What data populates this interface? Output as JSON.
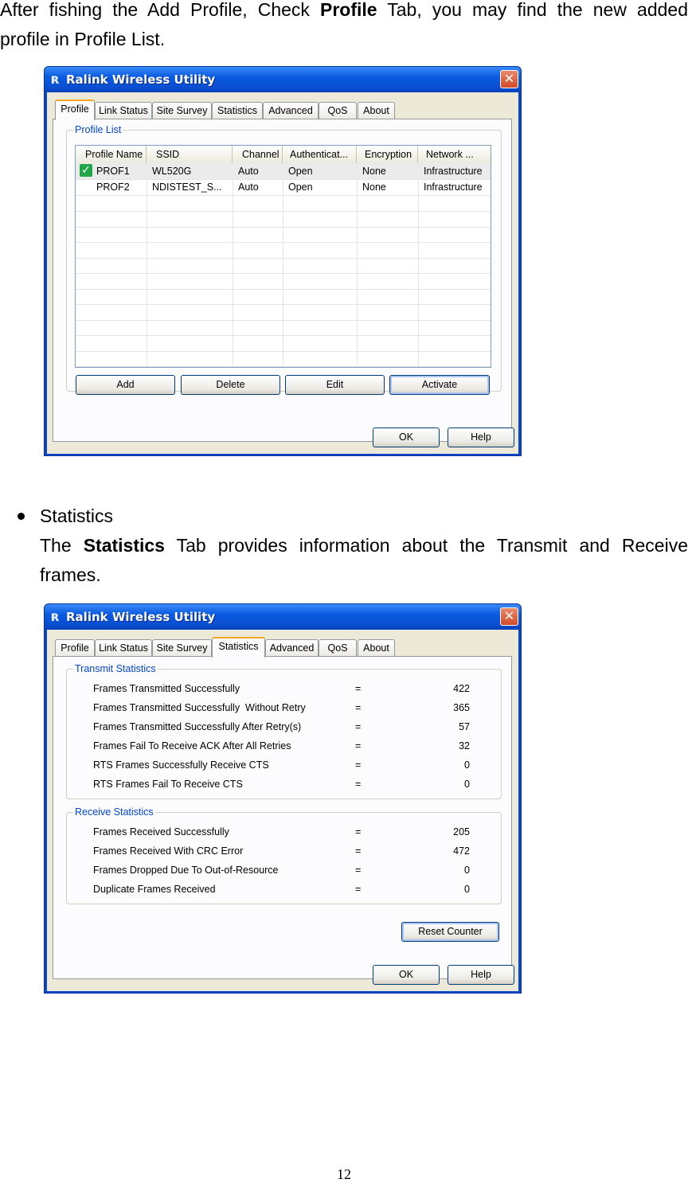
{
  "intro": {
    "line1_a": "After fishing the Add Profile, Check ",
    "line1_b": "Profile",
    "line1_c": " Tab, you may find the new added",
    "line2": "profile in Profile List."
  },
  "section": {
    "bullet_title": "Statistics",
    "desc_a": "The ",
    "desc_b": "Statistics",
    "desc_c": " Tab provides information about the Transmit and Receive",
    "desc_d": "frames."
  },
  "window": {
    "title": "Ralink Wireless Utility",
    "icon": "ralink-logo-icon",
    "close": "✕",
    "tabs": [
      "Profile",
      "Link Status",
      "Site Survey",
      "Statistics",
      "Advanced",
      "QoS",
      "About"
    ],
    "ok": "OK",
    "help": "Help"
  },
  "profile": {
    "group_label": "Profile List",
    "columns": [
      "Profile Name",
      "SSID",
      "Channel",
      "Authenticat...",
      "Encryption",
      "Network ..."
    ],
    "rows": [
      {
        "name": "PROF1",
        "ssid": "WL520G",
        "channel": "Auto",
        "auth": "Open",
        "enc": "None",
        "net": "Infrastructure",
        "active": true
      },
      {
        "name": "PROF2",
        "ssid": "NDISTEST_S...",
        "channel": "Auto",
        "auth": "Open",
        "enc": "None",
        "net": "Infrastructure",
        "active": false
      }
    ],
    "buttons": [
      "Add",
      "Delete",
      "Edit",
      "Activate"
    ]
  },
  "statistics": {
    "transmit_label": "Transmit Statistics",
    "transmit": [
      {
        "label": "Frames Transmitted Successfully",
        "value": "422"
      },
      {
        "label": "Frames Transmitted Successfully  Without Retry",
        "value": "365"
      },
      {
        "label": "Frames Transmitted Successfully After Retry(s)",
        "value": "57"
      },
      {
        "label": "Frames Fail To Receive ACK After All Retries",
        "value": "32"
      },
      {
        "label": "RTS Frames Successfully Receive CTS",
        "value": "0"
      },
      {
        "label": "RTS Frames Fail To Receive CTS",
        "value": "0"
      }
    ],
    "receive_label": "Receive Statistics",
    "receive": [
      {
        "label": "Frames Received Successfully",
        "value": "205"
      },
      {
        "label": "Frames Received With CRC Error",
        "value": "472"
      },
      {
        "label": "Frames Dropped Due To Out-of-Resource",
        "value": "0"
      },
      {
        "label": "Duplicate Frames Received",
        "value": "0"
      }
    ],
    "equals": "=",
    "reset": "Reset Counter"
  },
  "page_number": "12"
}
